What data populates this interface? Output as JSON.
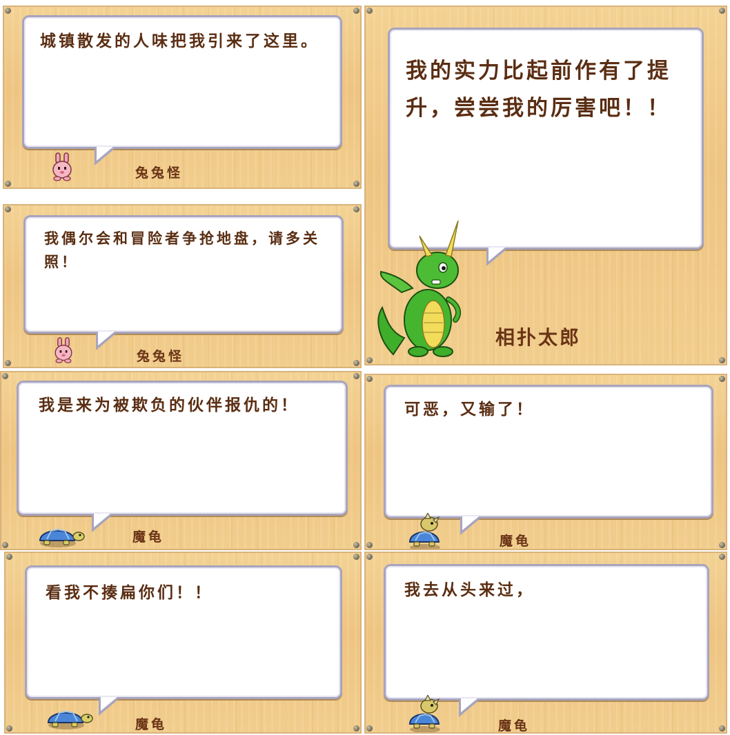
{
  "panels": [
    {
      "text": "城镇散发的人味把我引来了这里。",
      "speaker": "兔兔怪",
      "portrait": "bunny-monster-icon"
    },
    {
      "text": "我偶尔会和冒险者争抢地盘，请多关照！",
      "speaker": "兔兔怪",
      "portrait": "bunny-monster-icon"
    },
    {
      "text": "我的实力比起前作有了提升，尝尝我的厉害吧！！",
      "speaker": "相扑太郎",
      "portrait": "green-dragon-icon"
    },
    {
      "text": "我是来为被欺负的伙伴报仇的！",
      "speaker": "魔龟",
      "portrait": "blue-turtle-icon"
    },
    {
      "text": "可恶，又输了！",
      "speaker": "魔龟",
      "portrait": "spiked-turtle-icon"
    },
    {
      "text": "看我不揍扁你们！！",
      "speaker": "魔龟",
      "portrait": "blue-turtle-icon"
    },
    {
      "text": "我去从头来过，",
      "speaker": "魔龟",
      "portrait": "spiked-turtle-icon"
    }
  ],
  "colors": {
    "wood": "#eec481",
    "bubble_border": "#a7a4be",
    "text": "#5a2d12"
  }
}
